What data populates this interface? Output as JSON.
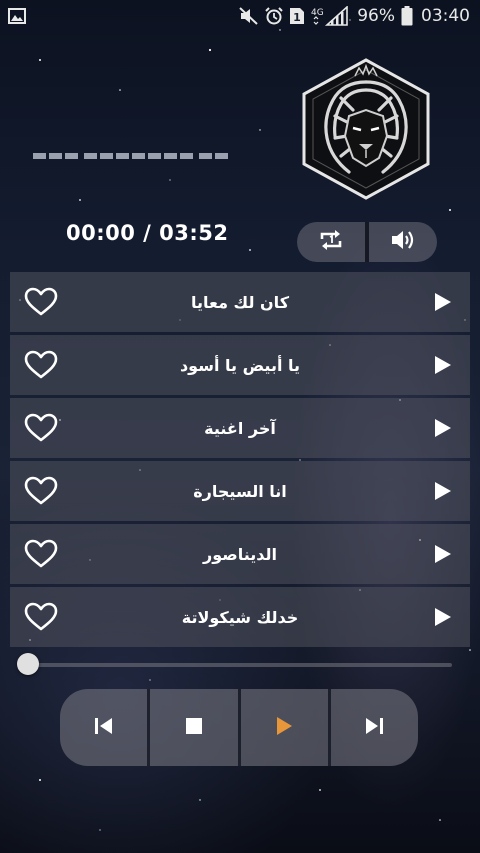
{
  "status_bar": {
    "battery": "96%",
    "time": "03:40",
    "network": "4G",
    "sim": "1",
    "icons": [
      "image-icon",
      "mute-icon",
      "alarm-icon",
      "sim-icon",
      "signal-icon",
      "battery-icon"
    ]
  },
  "player": {
    "time": "00:00 / 03:52",
    "logo": "lion-logo",
    "progress": 0
  },
  "songs": [
    {
      "title": "كان لك معايا"
    },
    {
      "title": "يا أبيض يا أسود"
    },
    {
      "title": "آخر اغنية"
    },
    {
      "title": "انا السيجارة"
    },
    {
      "title": "الديناصور"
    },
    {
      "title": "خدلك شيكولاتة"
    }
  ],
  "colors": {
    "accent": "#e8963a",
    "icon": "#ffffff",
    "row_bg": "#50525c"
  }
}
